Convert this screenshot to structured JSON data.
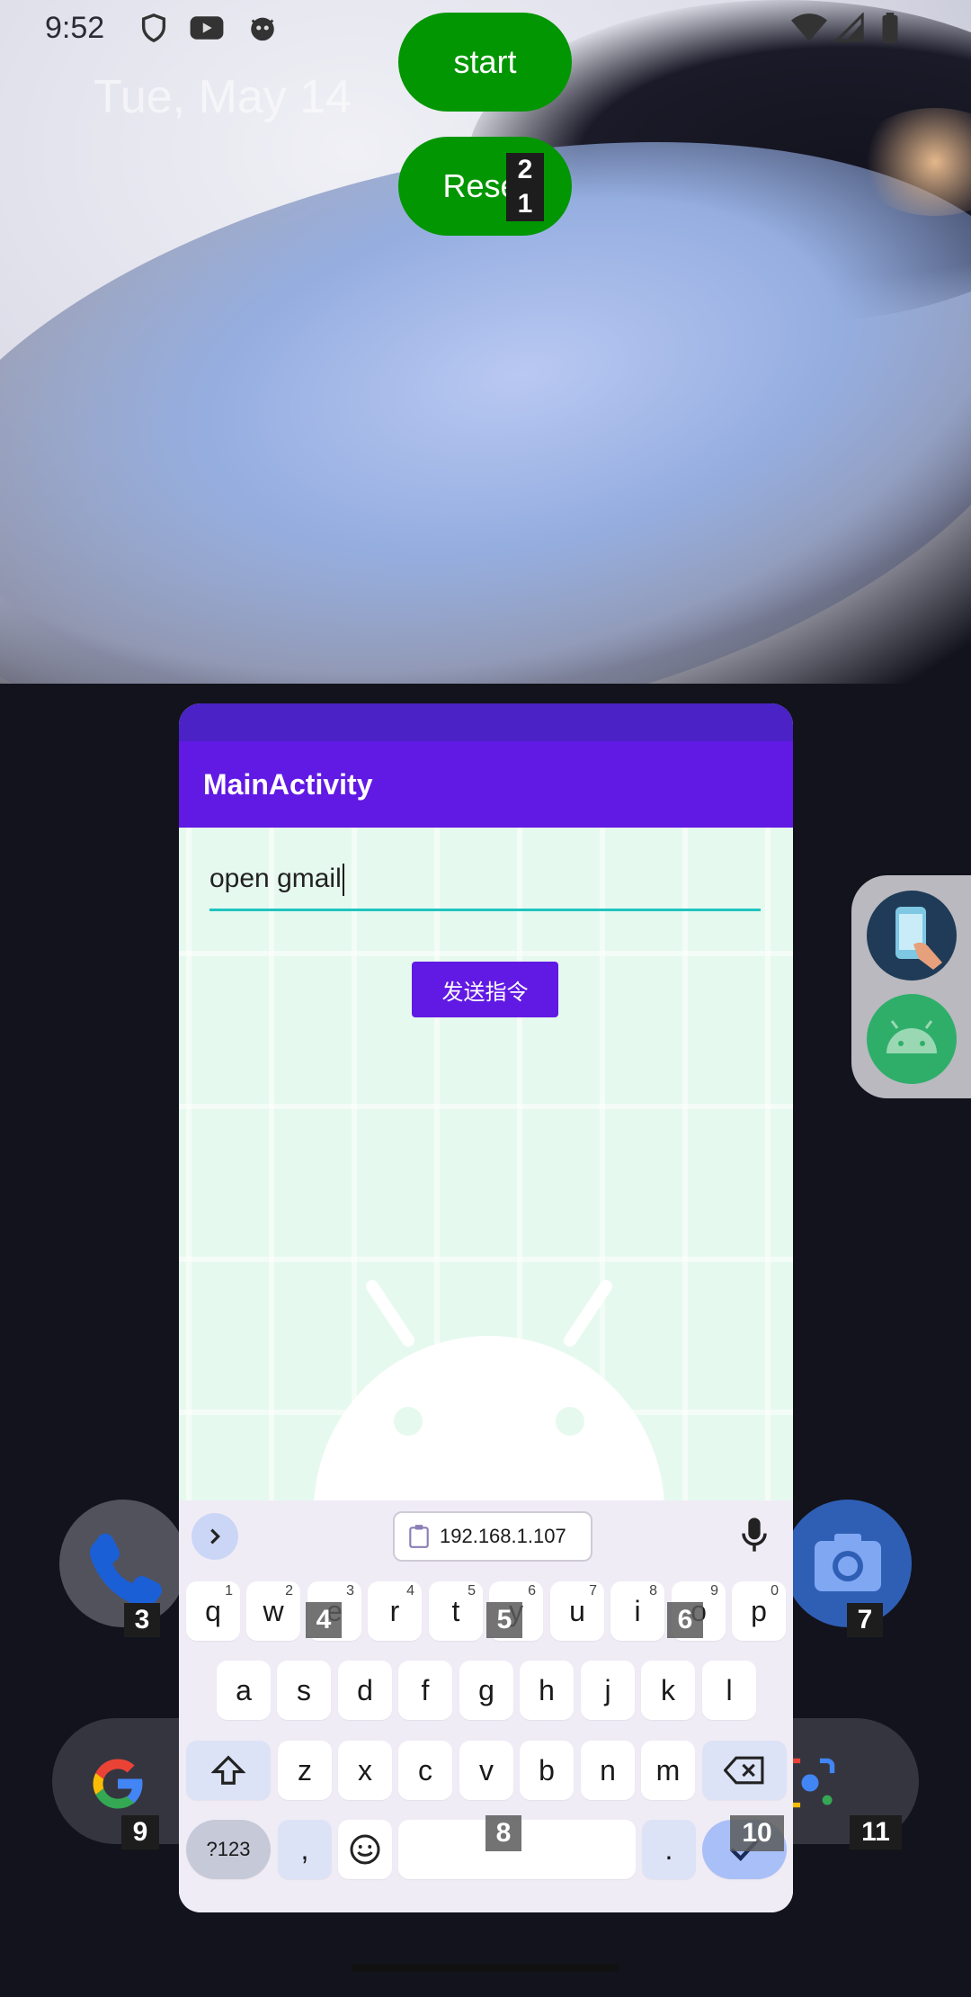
{
  "status_bar": {
    "time": "9:52",
    "date": "Tue, May 14",
    "icons": [
      "shield-icon",
      "youtube-icon",
      "cat-icon",
      "wifi-icon",
      "signal-icon",
      "battery-icon"
    ]
  },
  "overlay_buttons": {
    "start_label": "start",
    "reset_label": "Reset"
  },
  "element_tags": {
    "t1": "1",
    "t2": "2",
    "t3": "3",
    "t4": "4",
    "t5": "5",
    "t6": "6",
    "t7": "7",
    "t8": "8",
    "t9": "9",
    "t10": "10",
    "t11": "11"
  },
  "app": {
    "title": "MainActivity",
    "input_value": "open gmail",
    "send_button_label": "发送指令"
  },
  "keyboard": {
    "clipboard_text": "192.168.1.107",
    "row1": [
      "q",
      "w",
      "e",
      "r",
      "t",
      "y",
      "u",
      "i",
      "o",
      "p"
    ],
    "row1_hints": [
      "1",
      "2",
      "3",
      "4",
      "5",
      "6",
      "7",
      "8",
      "9",
      "0"
    ],
    "row2": [
      "a",
      "s",
      "d",
      "f",
      "g",
      "h",
      "j",
      "k",
      "l"
    ],
    "row3": [
      "z",
      "x",
      "c",
      "v",
      "b",
      "n",
      "m"
    ],
    "symbols_label": "?123",
    "comma": ",",
    "period": "."
  },
  "colors": {
    "accent": "#6119e4",
    "overlay_green": "#029602",
    "input_underline": "#1fc4c0"
  }
}
